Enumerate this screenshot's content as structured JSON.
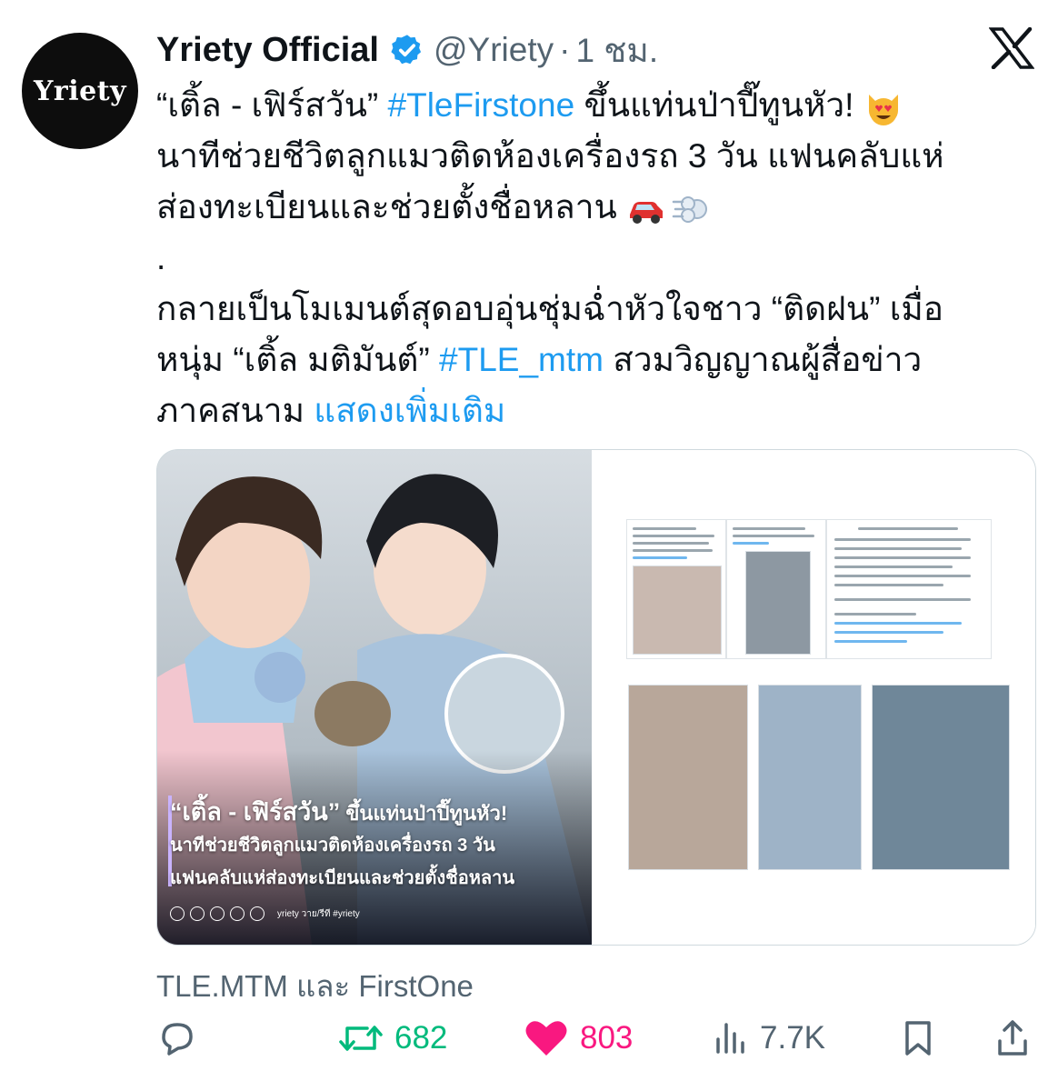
{
  "author": {
    "avatar_text": "Yriety",
    "display_name": "Yriety Official",
    "handle": "@Yriety",
    "separator": "·",
    "time": "1 ชม."
  },
  "tweet": {
    "line1_pre": "“เติ้ล - เฟิร์สวัน” ",
    "line1_tag": "#TleFirstone",
    "line1_post": " ขึ้นแท่นป่าปี๊ทูนหัว! ",
    "line2": "นาทีช่วยชีวิตลูกแมวติดห้องเครื่องรถ 3 วัน แฟนคลับแห่",
    "line3": "ส่องทะเบียนและช่วยตั้งชื่อหลาน ",
    "line4": ".",
    "line5": "กลายเป็นโมเมนต์สุดอบอุ่นชุ่มฉ่ำหัวใจชาว “ติดฝน” เมื่อ",
    "line6_pre": "หนุ่ม “เติ้ล มติมันต์” ",
    "line6_tag": "#TLE_mtm",
    "line6_post": " สวมวิญญาณผู้สื่อข่าว",
    "line7_pre": "ภาคสนาม ",
    "show_more": "แสดงเพิ่มเติม"
  },
  "media": {
    "overlay_line1_a": "“เติ้ล - เฟิร์สวัน”",
    "overlay_line1_b": " ขึ้นแท่นป่าปี๊ทูนหัว!",
    "overlay_line2": "นาทีช่วยชีวิตลูกแมวติดห้องเครื่องรถ 3 วัน",
    "overlay_line3": "แฟนคลับแห่ส่องทะเบียนและช่วยตั้งชื่อหลาน",
    "overlay_social": "yriety  วาย/รีที #yriety"
  },
  "tagged_users": "TLE.MTM และ FirstOne",
  "actions": {
    "reply_count": "",
    "retweet_count": "682",
    "like_count": "803",
    "views_count": "7.7K"
  },
  "colors": {
    "link": "#1d9bf0",
    "retweet": "#00ba7c",
    "like": "#f91880",
    "muted": "#536471",
    "text": "#0f1419",
    "verified": "#1d9bf0"
  },
  "icons": [
    "verified-badge-icon",
    "x-logo-icon",
    "smiling-cat-heart-eyes-icon",
    "car-icon",
    "dash-icon",
    "reply-icon",
    "retweet-icon",
    "like-icon",
    "views-icon",
    "bookmark-icon",
    "share-icon"
  ]
}
